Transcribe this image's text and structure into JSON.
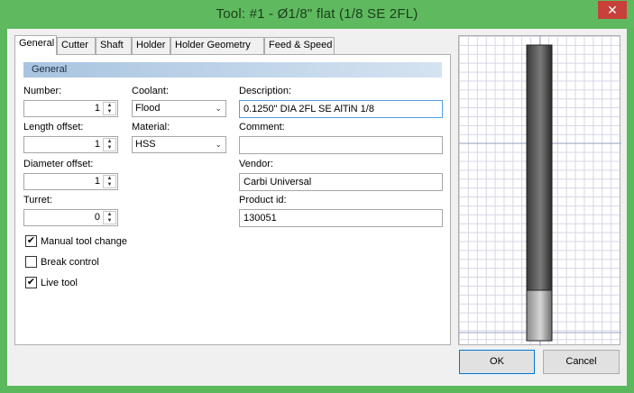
{
  "window": {
    "title": "Tool: #1 - Ø1/8\" flat (1/8 SE 2FL)",
    "close_glyph": "✕"
  },
  "tabs": [
    {
      "label": "General"
    },
    {
      "label": "Cutter"
    },
    {
      "label": "Shaft"
    },
    {
      "label": "Holder"
    },
    {
      "label": "Holder Geometry"
    },
    {
      "label": "Feed & Speed"
    }
  ],
  "section": {
    "title": "General"
  },
  "fields": {
    "number": {
      "label": "Number:",
      "value": "1"
    },
    "length_offset": {
      "label": "Length offset:",
      "value": "1"
    },
    "diameter_offset": {
      "label": "Diameter offset:",
      "value": "1"
    },
    "turret": {
      "label": "Turret:",
      "value": "0"
    },
    "coolant": {
      "label": "Coolant:",
      "value": "Flood"
    },
    "material": {
      "label": "Material:",
      "value": "HSS"
    },
    "description": {
      "label": "Description:",
      "value": "0.1250\" DIA 2FL SE AlTiN 1/8"
    },
    "comment": {
      "label": "Comment:",
      "value": ""
    },
    "vendor": {
      "label": "Vendor:",
      "value": "Carbi Universal"
    },
    "product_id": {
      "label": "Product id:",
      "value": "130051"
    }
  },
  "checkboxes": {
    "manual_tool_change": {
      "label": "Manual tool change",
      "checked": true
    },
    "break_control": {
      "label": "Break control",
      "checked": false
    },
    "live_tool": {
      "label": "Live tool",
      "checked": true
    }
  },
  "buttons": {
    "ok": "OK",
    "cancel": "Cancel"
  },
  "icons": {
    "check": "✔",
    "up": "▲",
    "down": "▼",
    "chevron": "⌄"
  },
  "colors": {
    "frame": "#5cb85c",
    "accent": "#0078d7"
  }
}
